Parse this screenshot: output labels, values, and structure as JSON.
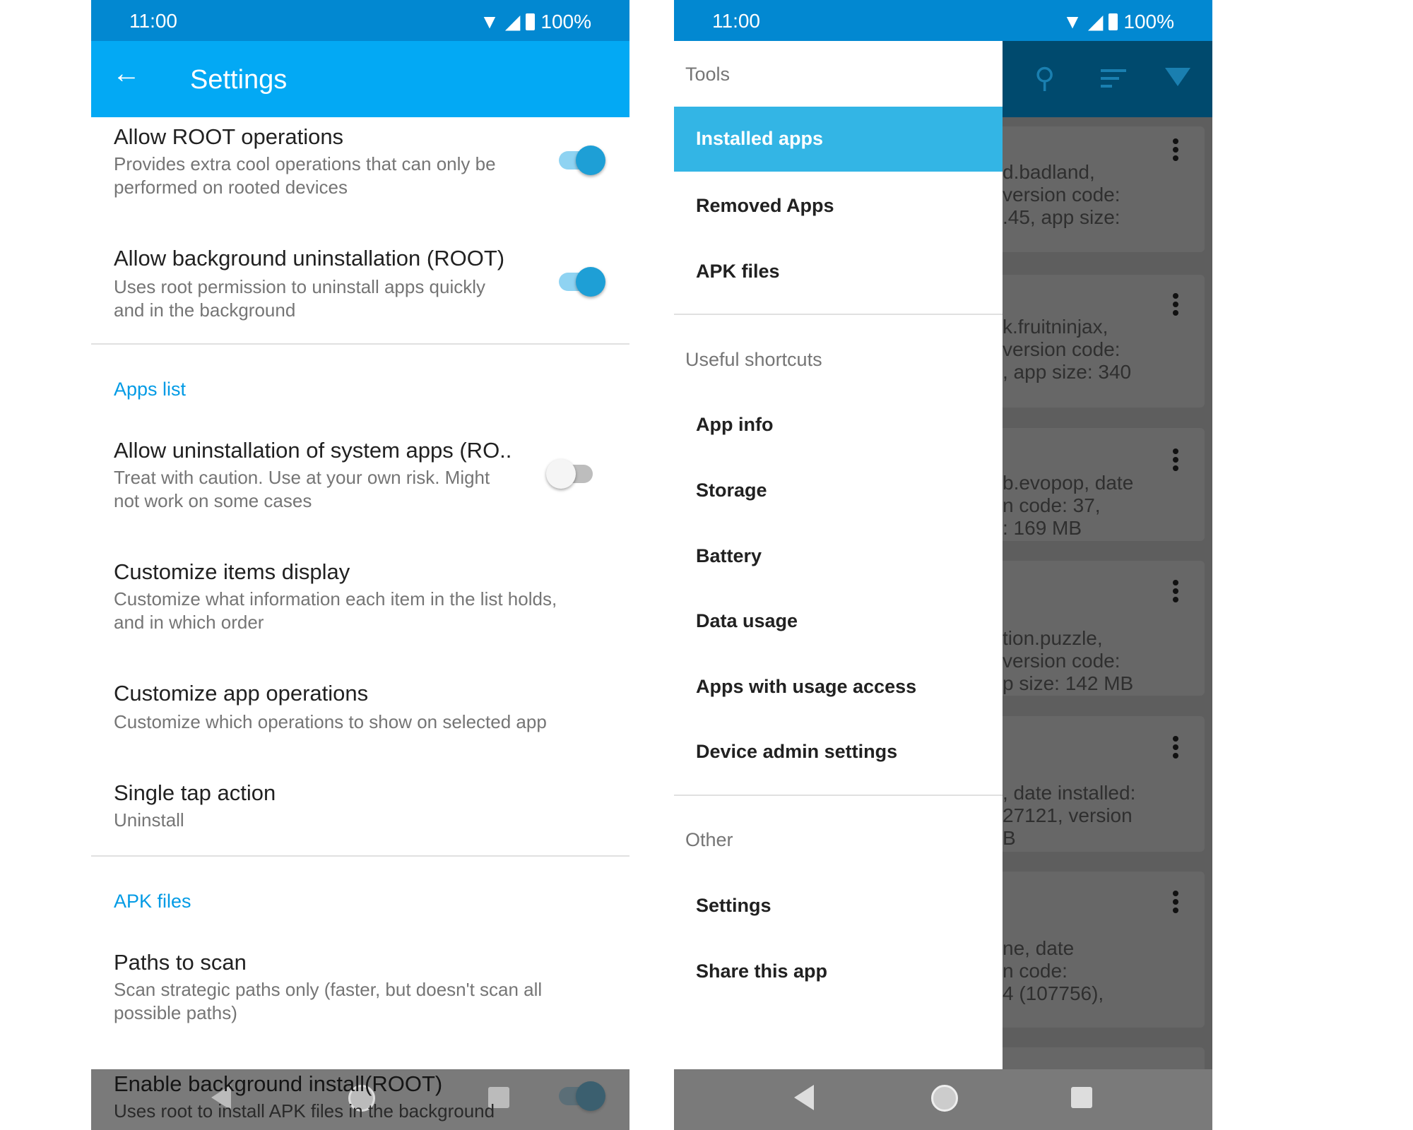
{
  "status": {
    "time": "11:00",
    "battery": "100%"
  },
  "settings": {
    "title": "Settings",
    "items": [
      {
        "title": "Allow ROOT operations",
        "summary": [
          "Provides extra cool operations that can only be",
          "performed on rooted devices"
        ],
        "toggle": true
      },
      {
        "title": "Allow background uninstallation (ROOT)",
        "summary": [
          "Uses root permission to uninstall apps quickly",
          "and in the background"
        ],
        "toggle": true
      }
    ],
    "apps_list": {
      "header": "Apps list",
      "items": [
        {
          "title": "Allow uninstallation of system apps (RO..",
          "summary": [
            "Treat with caution. Use at your own risk. Might",
            "not work on some cases"
          ],
          "toggle": false
        },
        {
          "title": "Customize items display",
          "summary": [
            "Customize what information each item in the list holds,",
            "and in which order"
          ]
        },
        {
          "title": "Customize app operations",
          "summary": [
            "Customize which operations to show on selected app"
          ]
        },
        {
          "title": "Single tap action",
          "summary": [
            "Uninstall"
          ]
        }
      ]
    },
    "apk_files": {
      "header": "APK files",
      "items": [
        {
          "title": "Paths to scan",
          "summary": [
            "Scan strategic paths only (faster, but doesn't scan all",
            "possible paths)"
          ]
        },
        {
          "title": "Enable background install(ROOT)",
          "summary": [
            "Uses root to install APK files in the background"
          ],
          "toggle": true
        }
      ]
    }
  },
  "drawer": {
    "tools_header": "Tools",
    "tools": [
      "Installed apps",
      "Removed Apps",
      "APK files"
    ],
    "shortcuts_header": "Useful shortcuts",
    "shortcuts": [
      "App info",
      "Storage",
      "Battery",
      "Data usage",
      "Apps with usage access",
      "Device admin settings"
    ],
    "other_header": "Other",
    "other": [
      "Settings",
      "Share this app"
    ],
    "selected": "Installed apps"
  },
  "background_list": {
    "cards": [
      [
        "d.badland,",
        "version code:",
        ".45, app size:"
      ],
      [
        "k.fruitninjax,",
        "version code:",
        ", app size: 340"
      ],
      [
        "b.evopop, date",
        "n code: 37,",
        ": 169 MB"
      ],
      [
        "tion.puzzle,",
        "version code:",
        "p size: 142 MB"
      ],
      [
        ", date installed:",
        "27121, version",
        "B"
      ],
      [
        "ne, date",
        "n code:",
        "4 (107756),"
      ]
    ]
  },
  "colors": {
    "primary": "#03a9f4",
    "primary_dark": "#0288d1",
    "accent": "#039be5",
    "drawer_selected": "#33b5e5"
  }
}
